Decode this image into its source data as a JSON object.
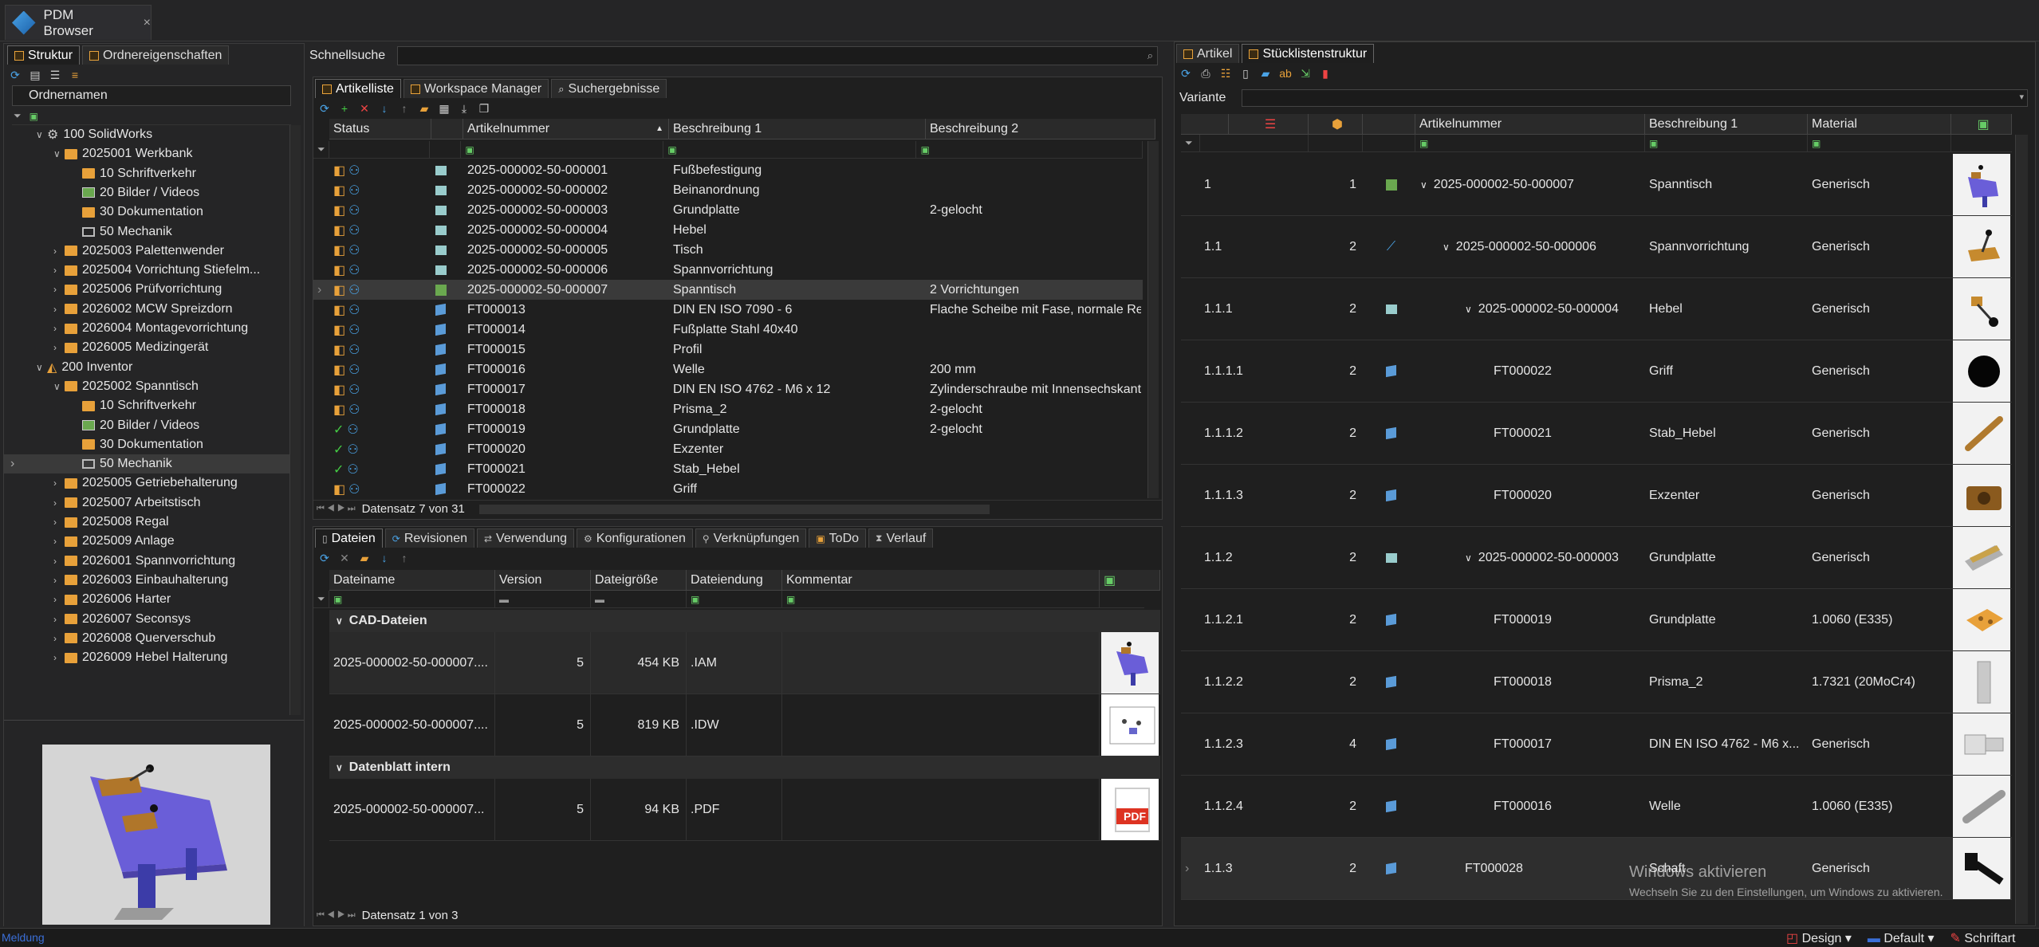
{
  "app": {
    "title": "PDM Browser",
    "close": "×"
  },
  "left": {
    "tabs": [
      "Struktur",
      "Ordnereigenschaften"
    ],
    "col_header": "Ordnernamen",
    "tree": [
      {
        "label": "100 SolidWorks",
        "level": 1,
        "chev": "∨",
        "icon": "sw"
      },
      {
        "label": "2025001 Werkbank",
        "level": 2,
        "chev": "∨",
        "icon": "folder"
      },
      {
        "label": "10 Schriftverkehr",
        "level": 3,
        "chev": "",
        "icon": "folder"
      },
      {
        "label": "20 Bilder / Videos",
        "level": 3,
        "chev": "",
        "icon": "pic"
      },
      {
        "label": "30 Dokumentation",
        "level": 3,
        "chev": "",
        "icon": "folder"
      },
      {
        "label": "50 Mechanik",
        "level": 3,
        "chev": "",
        "icon": "mon"
      },
      {
        "label": "2025003 Palettenwender",
        "level": 2,
        "chev": "›",
        "icon": "folder"
      },
      {
        "label": "2025004 Vorrichtung Stiefelm...",
        "level": 2,
        "chev": "›",
        "icon": "folder"
      },
      {
        "label": "2025006 Prüfvorrichtung",
        "level": 2,
        "chev": "›",
        "icon": "folder"
      },
      {
        "label": "2026002 MCW Spreizdorn",
        "level": 2,
        "chev": "›",
        "icon": "folder"
      },
      {
        "label": "2026004 Montagevorrichtung",
        "level": 2,
        "chev": "›",
        "icon": "folder"
      },
      {
        "label": "2026005 Medizingerät",
        "level": 2,
        "chev": "›",
        "icon": "folder"
      },
      {
        "label": "200 Inventor",
        "level": 1,
        "chev": "∨",
        "icon": "inv"
      },
      {
        "label": "2025002 Spanntisch",
        "level": 2,
        "chev": "∨",
        "icon": "folder"
      },
      {
        "label": "10 Schriftverkehr",
        "level": 3,
        "chev": "",
        "icon": "folder"
      },
      {
        "label": "20 Bilder / Videos",
        "level": 3,
        "chev": "",
        "icon": "pic"
      },
      {
        "label": "30 Dokumentation",
        "level": 3,
        "chev": "",
        "icon": "folder"
      },
      {
        "label": "50 Mechanik",
        "level": 3,
        "chev": "",
        "icon": "mon",
        "selected": true
      },
      {
        "label": "2025005 Getriebehalterung",
        "level": 2,
        "chev": "›",
        "icon": "folder"
      },
      {
        "label": "2025007 Arbeitstisch",
        "level": 2,
        "chev": "›",
        "icon": "folder"
      },
      {
        "label": "2025008 Regal",
        "level": 2,
        "chev": "›",
        "icon": "folder"
      },
      {
        "label": "2025009 Anlage",
        "level": 2,
        "chev": "›",
        "icon": "folder"
      },
      {
        "label": "2026001 Spannvorrichtung",
        "level": 2,
        "chev": "›",
        "icon": "folder"
      },
      {
        "label": "2026003 Einbauhalterung",
        "level": 2,
        "chev": "›",
        "icon": "folder"
      },
      {
        "label": "2026006 Harter",
        "level": 2,
        "chev": "›",
        "icon": "folder"
      },
      {
        "label": "2026007 Seconsys",
        "level": 2,
        "chev": "›",
        "icon": "folder"
      },
      {
        "label": "2026008 Querverschub",
        "level": 2,
        "chev": "›",
        "icon": "folder"
      },
      {
        "label": "2026009 Hebel Halterung",
        "level": 2,
        "chev": "›",
        "icon": "folder"
      }
    ]
  },
  "middle": {
    "quicksearch_label": "Schnellsuche",
    "tabs": [
      "Artikelliste",
      "Workspace Manager",
      "Suchergebnisse"
    ],
    "columns": [
      "Status",
      "Artikelnummer",
      "Beschreibung 1",
      "Beschreibung 2"
    ],
    "rows": [
      {
        "nr": "2025-000002-50-000001",
        "b1": "Fußbefestigung",
        "b2": "",
        "st": "e"
      },
      {
        "nr": "2025-000002-50-000002",
        "b1": "Beinanordnung",
        "b2": "",
        "st": "e"
      },
      {
        "nr": "2025-000002-50-000003",
        "b1": "Grundplatte",
        "b2": "2-gelocht",
        "st": "e"
      },
      {
        "nr": "2025-000002-50-000004",
        "b1": "Hebel",
        "b2": "",
        "st": "e"
      },
      {
        "nr": "2025-000002-50-000005",
        "b1": "Tisch",
        "b2": "",
        "st": "e"
      },
      {
        "nr": "2025-000002-50-000006",
        "b1": "Spannvorrichtung",
        "b2": "",
        "st": "e"
      },
      {
        "nr": "2025-000002-50-000007",
        "b1": "Spanntisch",
        "b2": "2 Vorrichtungen",
        "st": "e",
        "selected": true
      },
      {
        "nr": "FT000013",
        "b1": "DIN EN ISO 7090 - 6",
        "b2": "Flache Scheibe mit Fase, normale Re",
        "st": "e"
      },
      {
        "nr": "FT000014",
        "b1": "Fußplatte Stahl 40x40",
        "b2": "",
        "st": "e"
      },
      {
        "nr": "FT000015",
        "b1": "Profil",
        "b2": "",
        "st": "e"
      },
      {
        "nr": "FT000016",
        "b1": "Welle",
        "b2": "200 mm",
        "st": "e"
      },
      {
        "nr": "FT000017",
        "b1": "DIN EN ISO 4762 - M6 x 12",
        "b2": "Zylinderschraube mit Innensechskant",
        "st": "e"
      },
      {
        "nr": "FT000018",
        "b1": "Prisma_2",
        "b2": "2-gelocht",
        "st": "e"
      },
      {
        "nr": "FT000019",
        "b1": "Grundplatte",
        "b2": "2-gelocht",
        "st": "ok"
      },
      {
        "nr": "FT000020",
        "b1": "Exzenter",
        "b2": "",
        "st": "ok"
      },
      {
        "nr": "FT000021",
        "b1": "Stab_Hebel",
        "b2": "",
        "st": "ok"
      },
      {
        "nr": "FT000022",
        "b1": "Griff",
        "b2": "",
        "st": "e"
      }
    ],
    "record_info": "Datensatz 7 von 31"
  },
  "files": {
    "tabs": [
      "Dateien",
      "Revisionen",
      "Verwendung",
      "Konfigurationen",
      "Verknüpfungen",
      "ToDo",
      "Verlauf"
    ],
    "columns": [
      "Dateiname",
      "Version",
      "Dateigröße",
      "Dateiendung",
      "Kommentar"
    ],
    "groups": [
      {
        "name": "CAD-Dateien",
        "items": [
          {
            "name": "2025-000002-50-000007....",
            "version": "5",
            "size": "454 KB",
            "ext": ".IAM",
            "thumb": "asm"
          },
          {
            "name": "2025-000002-50-000007....",
            "version": "5",
            "size": "819 KB",
            "ext": ".IDW",
            "thumb": "drw"
          }
        ]
      },
      {
        "name": "Datenblatt intern",
        "items": [
          {
            "name": "2025-000002-50-000007...",
            "version": "5",
            "size": "94 KB",
            "ext": ".PDF",
            "thumb": "pdf"
          }
        ]
      }
    ],
    "pdf_label": "PDF",
    "record_info": "Datensatz 1 von 3"
  },
  "right": {
    "tabs": [
      "Artikel",
      "Stücklistenstruktur"
    ],
    "variante_label": "Variante",
    "columns": [
      "Artikelnummer",
      "Beschreibung 1",
      "Material"
    ],
    "rows": [
      {
        "pos": "1",
        "qty": "1",
        "nr": "2025-000002-50-000007",
        "b1": "Spanntisch",
        "mat": "Generisch",
        "indent": 0,
        "chev": "∨",
        "icon": "asm"
      },
      {
        "pos": "1.1",
        "qty": "2",
        "nr": "2025-000002-50-000006",
        "b1": "Spannvorrichtung",
        "mat": "Generisch",
        "indent": 1,
        "chev": "∨",
        "icon": "tool"
      },
      {
        "pos": "1.1.1",
        "qty": "2",
        "nr": "2025-000002-50-000004",
        "b1": "Hebel",
        "mat": "Generisch",
        "indent": 2,
        "chev": "∨",
        "icon": "part"
      },
      {
        "pos": "1.1.1.1",
        "qty": "2",
        "nr": "FT000022",
        "b1": "Griff",
        "mat": "Generisch",
        "indent": 3,
        "chev": "",
        "icon": "cube"
      },
      {
        "pos": "1.1.1.2",
        "qty": "2",
        "nr": "FT000021",
        "b1": "Stab_Hebel",
        "mat": "Generisch",
        "indent": 3,
        "chev": "",
        "icon": "cube"
      },
      {
        "pos": "1.1.1.3",
        "qty": "2",
        "nr": "FT000020",
        "b1": "Exzenter",
        "mat": "Generisch",
        "indent": 3,
        "chev": "",
        "icon": "cube"
      },
      {
        "pos": "1.1.2",
        "qty": "2",
        "nr": "2025-000002-50-000003",
        "b1": "Grundplatte",
        "mat": "Generisch",
        "indent": 2,
        "chev": "∨",
        "icon": "part"
      },
      {
        "pos": "1.1.2.1",
        "qty": "2",
        "nr": "FT000019",
        "b1": "Grundplatte",
        "mat": "1.0060 (E335)",
        "indent": 3,
        "chev": "",
        "icon": "cube"
      },
      {
        "pos": "1.1.2.2",
        "qty": "2",
        "nr": "FT000018",
        "b1": "Prisma_2",
        "mat": "1.7321 (20MoCr4)",
        "indent": 3,
        "chev": "",
        "icon": "cube"
      },
      {
        "pos": "1.1.2.3",
        "qty": "4",
        "nr": "FT000017",
        "b1": "DIN EN ISO 4762 - M6 x...",
        "mat": "Generisch",
        "indent": 3,
        "chev": "",
        "icon": "cube"
      },
      {
        "pos": "1.1.2.4",
        "qty": "2",
        "nr": "FT000016",
        "b1": "Welle",
        "mat": "1.0060 (E335)",
        "indent": 3,
        "chev": "",
        "icon": "cube"
      },
      {
        "pos": "1.1.3",
        "qty": "2",
        "nr": "FT000028",
        "b1": "Schaft",
        "mat": "Generisch",
        "indent": 2,
        "chev": "",
        "icon": "cube",
        "selected": true
      }
    ]
  },
  "watermark": {
    "line1": "Windows aktivieren",
    "line2": "Wechseln Sie zu den Einstellungen, um Windows zu aktivieren."
  },
  "statusbar": {
    "left": "Meldung",
    "design": "Design",
    "default": "Default",
    "font": "Schriftart"
  },
  "colors": {
    "accent": "#e8a13a",
    "bg": "#1f1f1f",
    "selected": "#3a3a3a"
  }
}
